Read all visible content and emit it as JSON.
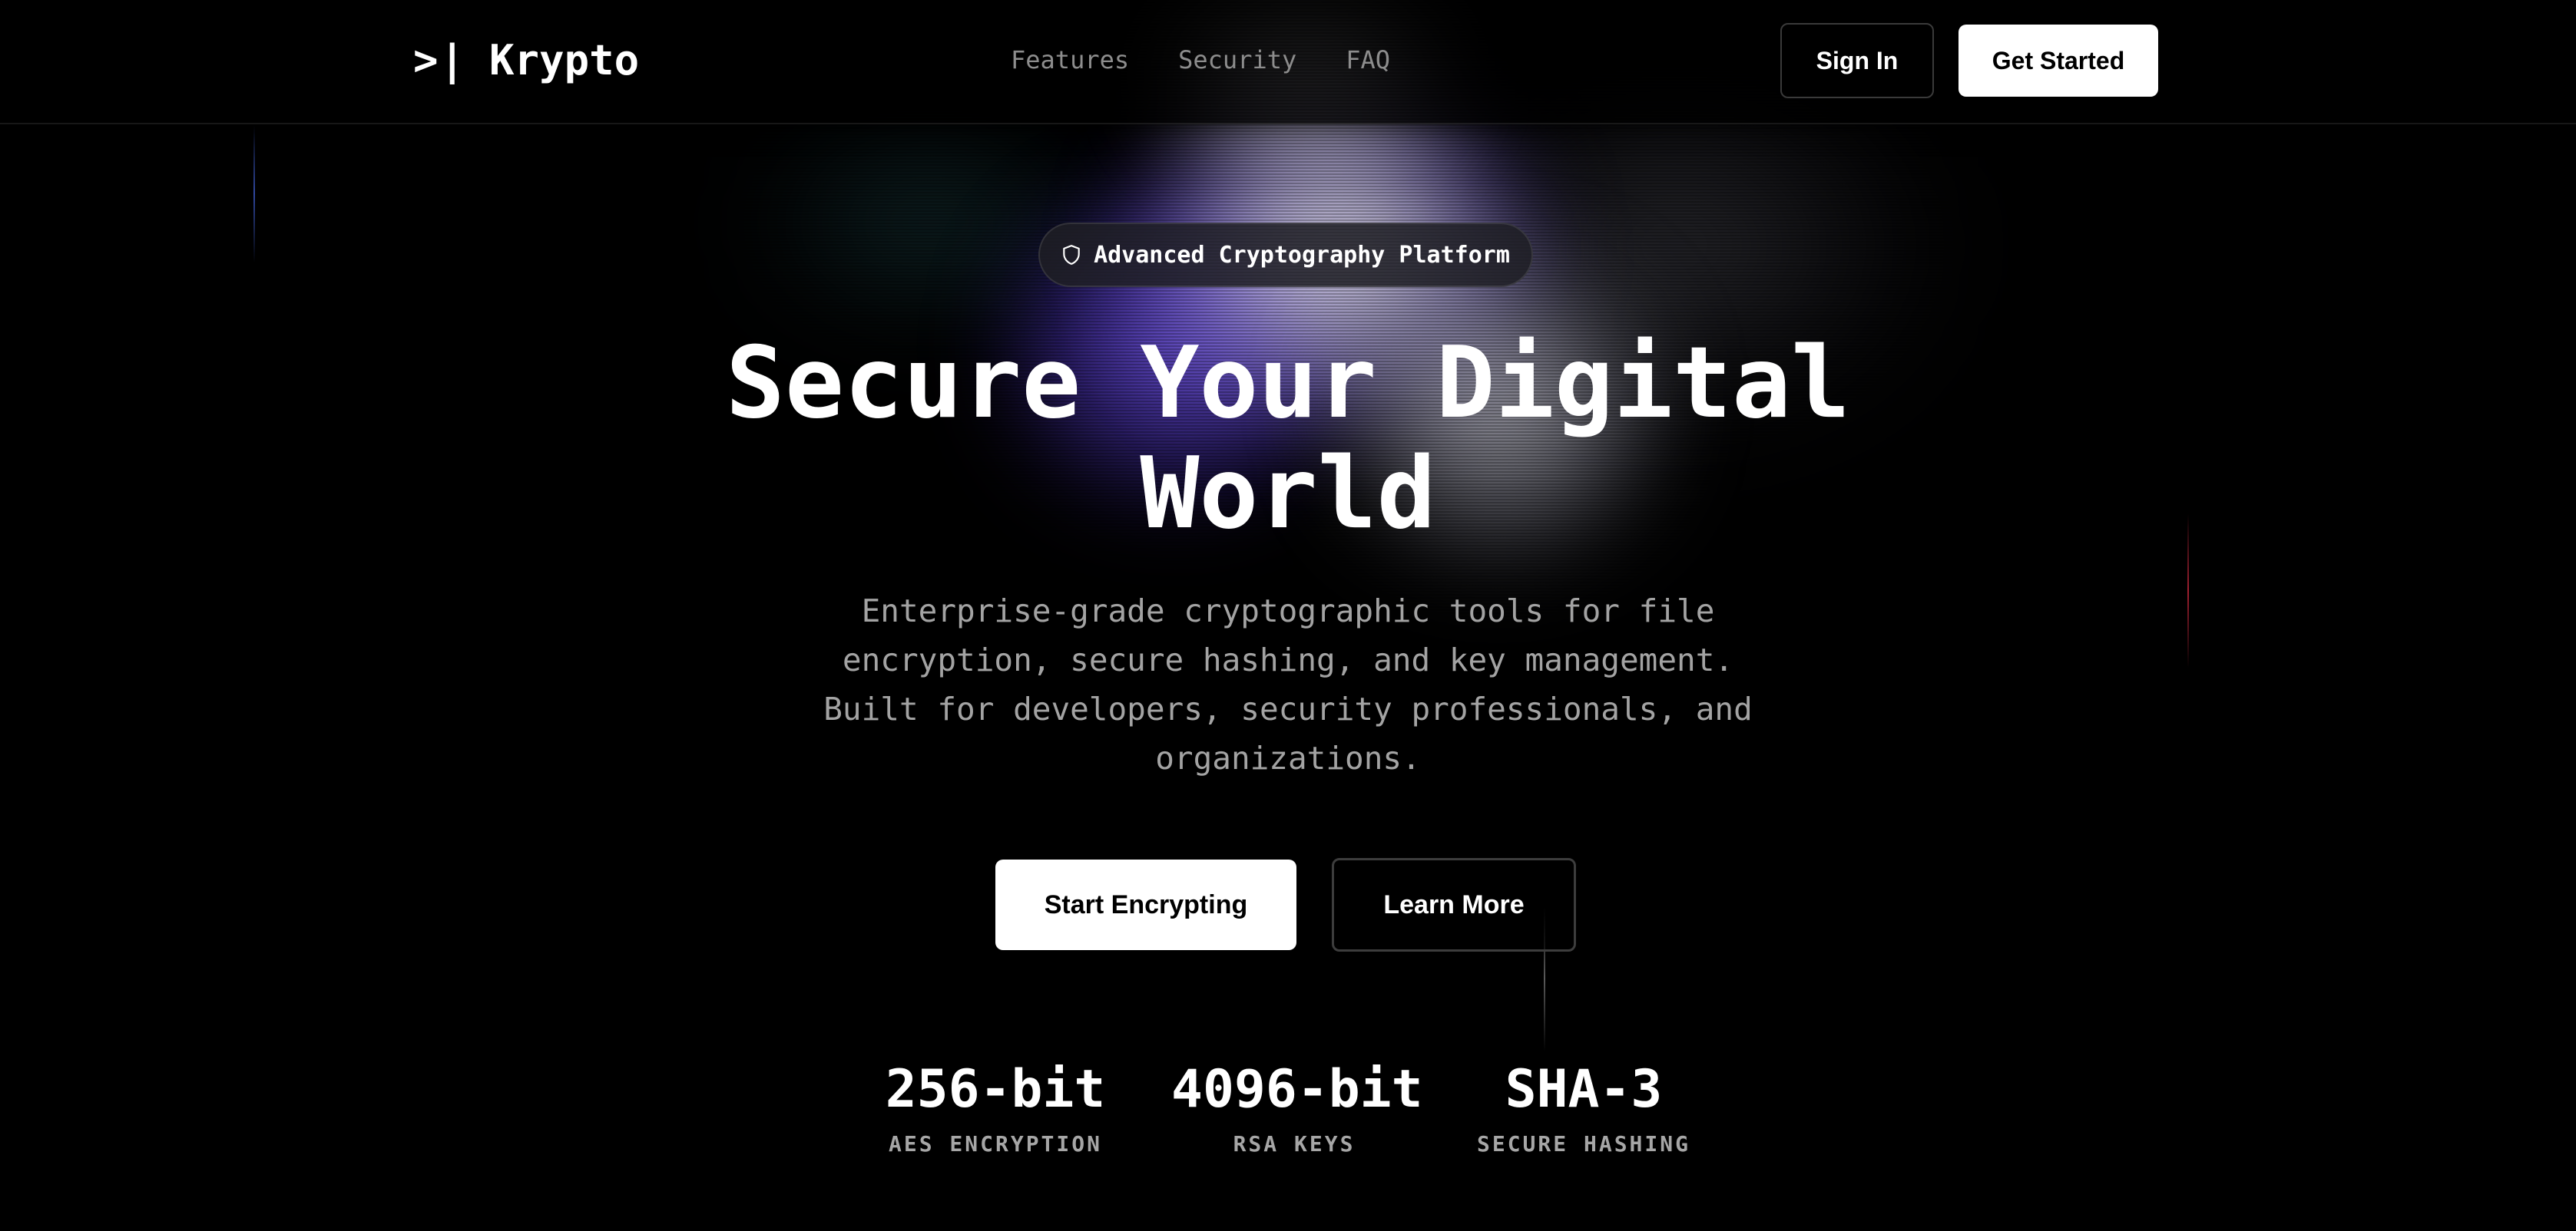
{
  "header": {
    "logo_mark": ">|",
    "logo_text": "Krypto",
    "nav": [
      "Features",
      "Security",
      "FAQ"
    ],
    "sign_in_label": "Sign In",
    "get_started_label": "Get Started"
  },
  "hero": {
    "badge_icon": "shield-icon",
    "badge_text": "Advanced Cryptography Platform",
    "title_line1": "Secure Your Digital",
    "title_line2": "World",
    "subtitle": "Enterprise-grade cryptographic tools for file encryption, secure hashing, and key management. Built for developers, security professionals, and organizations.",
    "primary_cta": "Start Encrypting",
    "secondary_cta": "Learn More"
  },
  "stats": [
    {
      "value": "256-bit",
      "label": "AES ENCRYPTION"
    },
    {
      "value": "4096-bit",
      "label": "RSA KEYS"
    },
    {
      "value": "SHA-3",
      "label": "SECURE HASHING"
    }
  ],
  "colors": {
    "background": "#000000",
    "nav_text": "#8d8d8d",
    "muted_text": "#a3a3a3",
    "accent_glow": "#7a5cff"
  }
}
